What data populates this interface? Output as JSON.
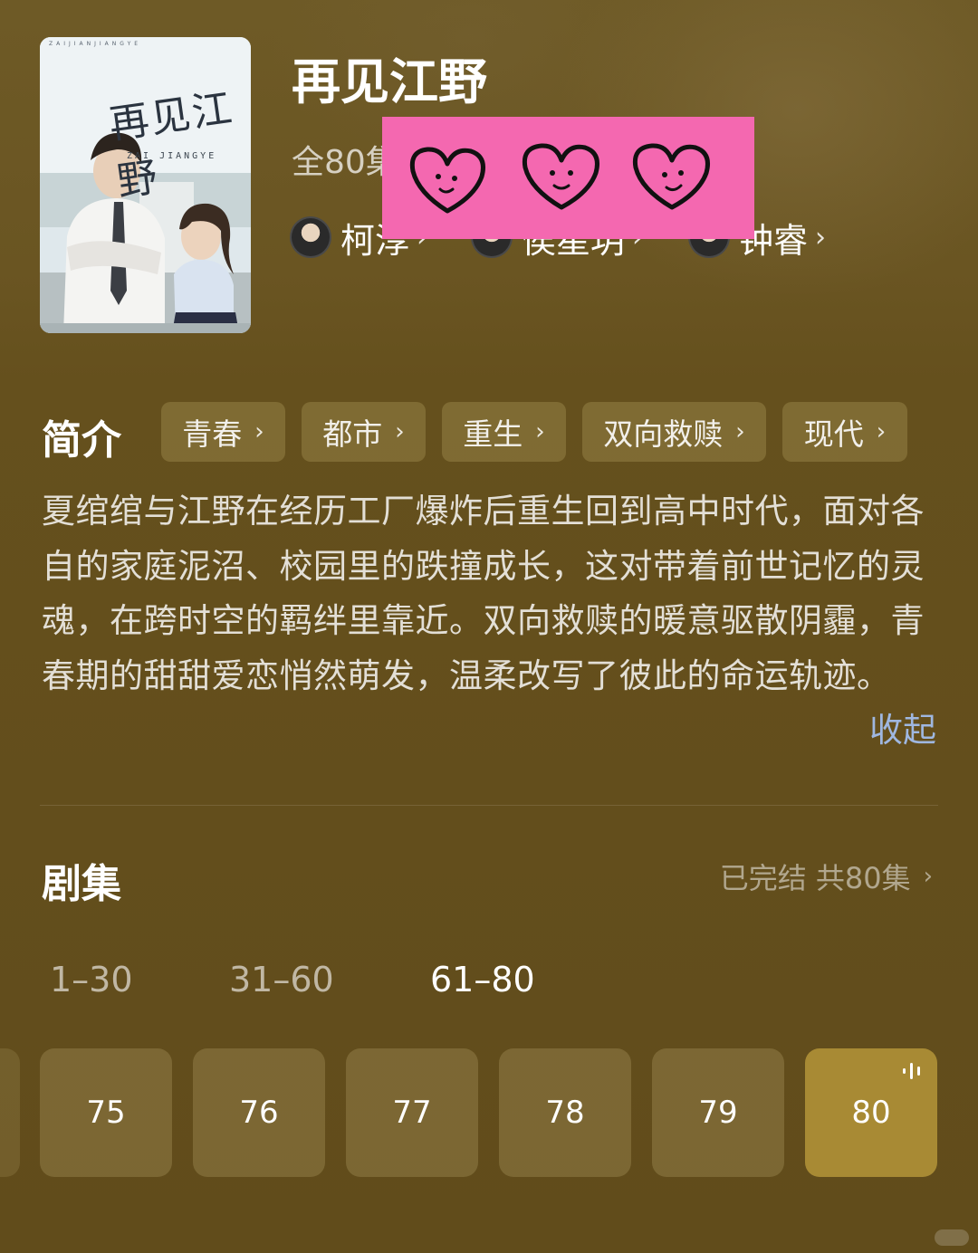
{
  "header": {
    "title": "再见江野",
    "episodes_info": "全80集",
    "poster": {
      "title": "再见江野",
      "romanized": "ZAIJIANJIANGYE",
      "subtitle": "ZAI JIANGYE"
    },
    "cast": [
      {
        "name": "柯淳"
      },
      {
        "name": "侯星玥"
      },
      {
        "name": "钟睿"
      }
    ]
  },
  "intro": {
    "title": "简介",
    "tags": [
      "青春",
      "都市",
      "重生",
      "双向救赎",
      "现代"
    ],
    "synopsis": "夏绾绾与江野在经历工厂爆炸后重生回到高中时代，面对各自的家庭泥沼、校园里的跌撞成长，这对带着前世记忆的灵魂，在跨时空的羁绊里靠近。双向救赎的暖意驱散阴霾，青春期的甜甜爱恋悄然萌发，温柔改写了彼此的命运轨迹。",
    "collapse_label": "收起"
  },
  "episodes": {
    "title": "剧集",
    "status": "已完结 共80集",
    "ranges": [
      {
        "label": "1–30",
        "active": false
      },
      {
        "label": "31–60",
        "active": false
      },
      {
        "label": "61–80",
        "active": true
      }
    ],
    "items": [
      "75",
      "76",
      "77",
      "78",
      "79",
      "80"
    ],
    "current": "80"
  },
  "colors": {
    "background": "#65501d",
    "accent": "#a88a34",
    "link": "#9fb7e0",
    "sticker": "#f468b0"
  },
  "icons": {
    "chevron": "chevron-right-icon",
    "playing": "playing-bars-icon",
    "sticker": "heart-face-icon"
  }
}
